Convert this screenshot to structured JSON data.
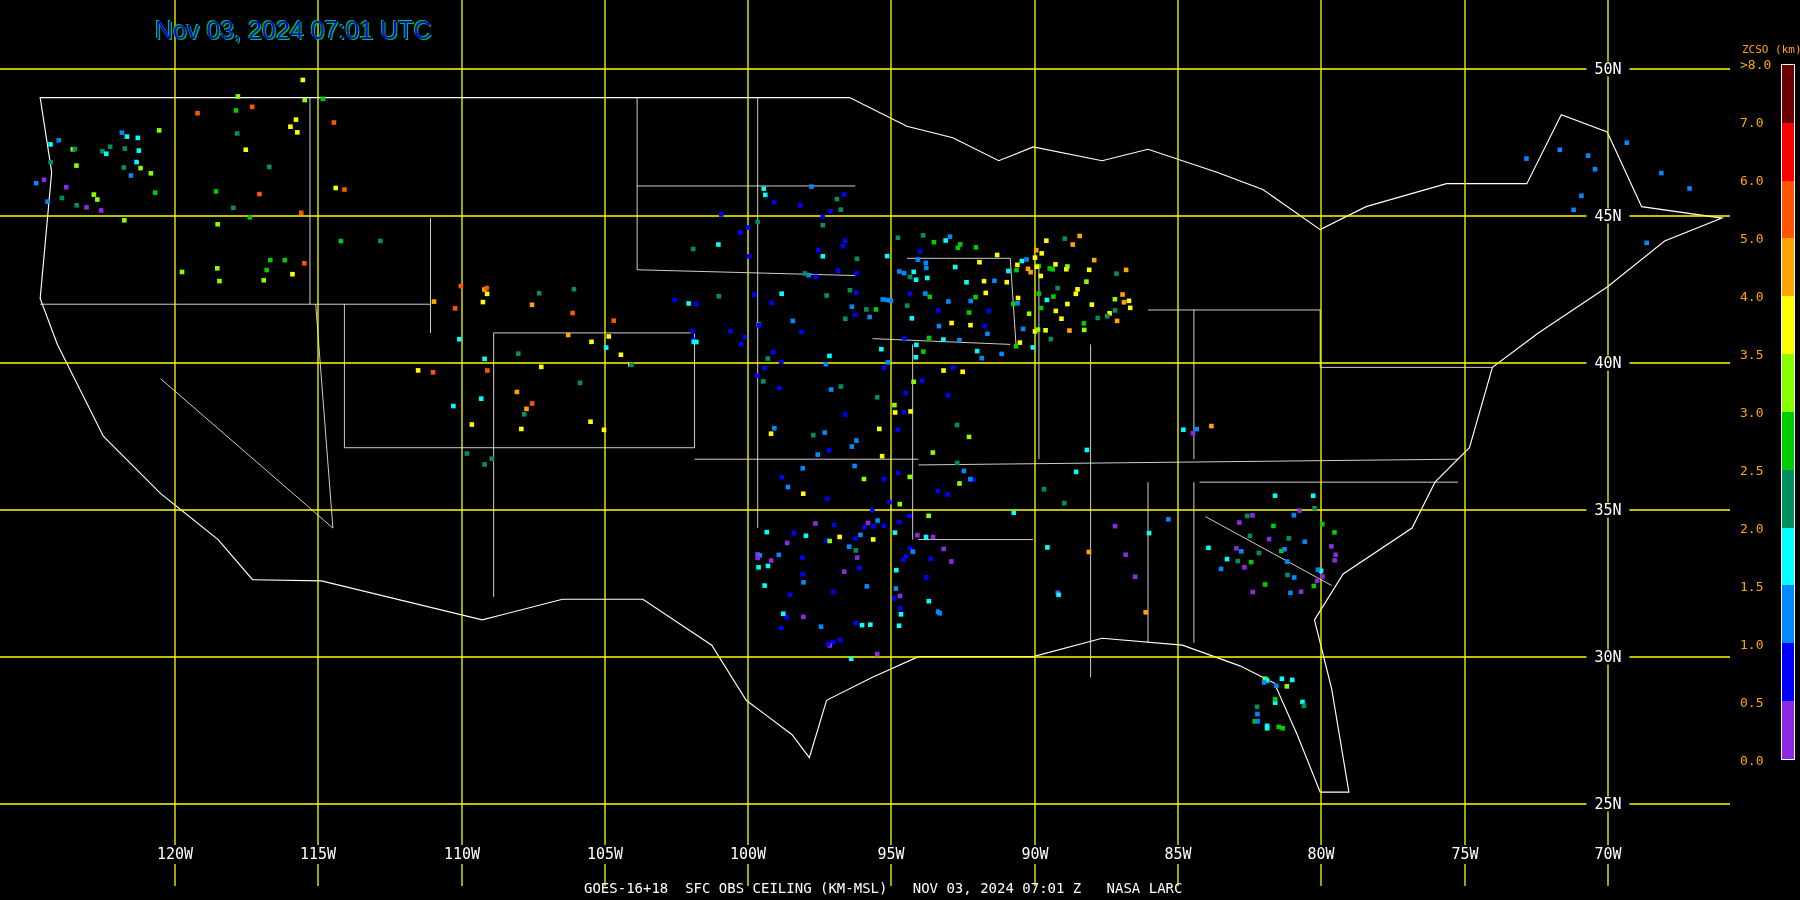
{
  "title": "Nov 03, 2024 07:01 UTC",
  "latitude_labels": [
    "50N",
    "45N",
    "40N",
    "35N",
    "30N",
    "25N"
  ],
  "longitude_labels": [
    "120W",
    "115W",
    "110W",
    "105W",
    "100W",
    "95W",
    "90W",
    "85W",
    "80W",
    "75W",
    "70W"
  ],
  "legend": {
    "title": "ZCSO (km)",
    "labels": [
      ">8.0",
      "7.0",
      "6.0",
      "5.0",
      "4.0",
      "3.5",
      "3.0",
      "2.5",
      "2.0",
      "1.5",
      "1.0",
      "0.5",
      "0.0"
    ],
    "segments": [
      {
        "color": "#6b0000"
      },
      {
        "color": "#ff0000"
      },
      {
        "color": "#ff5500"
      },
      {
        "color": "#ffa500"
      },
      {
        "color": "#ffff00"
      },
      {
        "color": "#88ff00"
      },
      {
        "color": "#00cc00"
      },
      {
        "color": "#009060"
      },
      {
        "color": "#00ffff"
      },
      {
        "color": "#0088ff"
      },
      {
        "color": "#0000ff"
      },
      {
        "color": "#8a2be2"
      }
    ]
  },
  "caption": "GOES-16+18  SFC OBS CEILING (KM-MSL)   NOV 03, 2024 07:01 Z   NASA LARC"
}
